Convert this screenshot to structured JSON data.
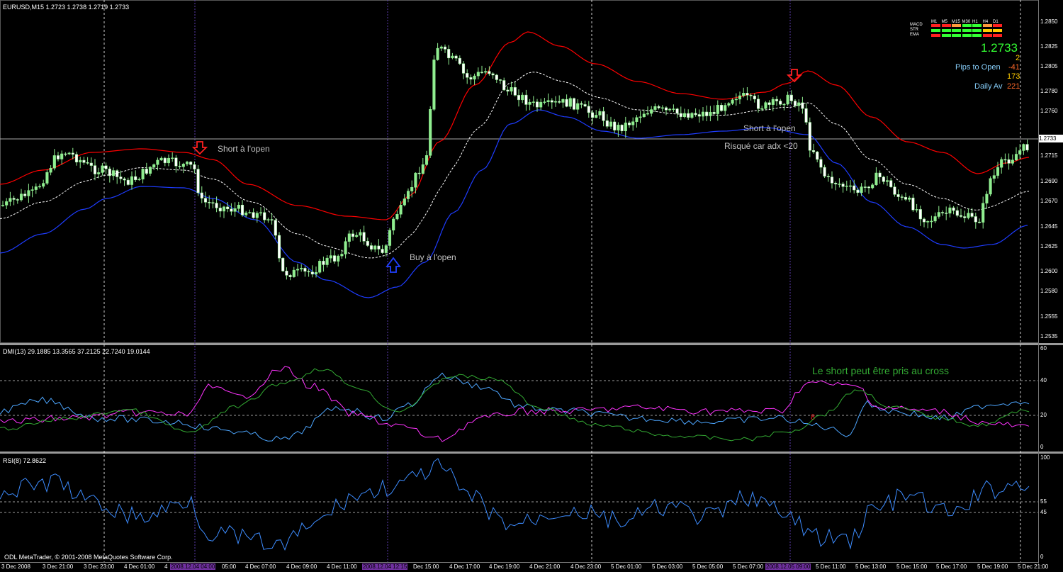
{
  "header": {
    "symbol": "EURUSD,M15  1.2723 1.2738 1.2719 1.2733",
    "dmi": "DMI(13) 29.1885 13.3565 37.2125 22.7240 19.0144",
    "rsi": "RSI(8) 72.8622"
  },
  "copyright": "ODL MetaTrader, © 2001-2008 MetaQuotes Software Corp.",
  "price_axis": [
    "1.2850",
    "1.2825",
    "1.2805",
    "1.2780",
    "1.2760",
    "1.2715",
    "1.2690",
    "1.2670",
    "1.2645",
    "1.2625",
    "1.2600",
    "1.2580",
    "1.2555",
    "1.2535"
  ],
  "current_price": "1.2733",
  "dmi_axis": [
    "60",
    "40",
    "20",
    "0"
  ],
  "rsi_axis": [
    "100",
    "55",
    "45",
    "0"
  ],
  "time_axis": [
    {
      "label": "3 Dec 2008",
      "hl": false
    },
    {
      "label": "3 Dec 21:00",
      "hl": false
    },
    {
      "label": "3 Dec 23:00",
      "hl": false
    },
    {
      "label": "4 Dec 01:00",
      "hl": false
    },
    {
      "label": "4",
      "hl": false
    },
    {
      "label": "2008.12.04 04:00",
      "hl": true
    },
    {
      "label": "05:00",
      "hl": false
    },
    {
      "label": "4 Dec 07:00",
      "hl": false
    },
    {
      "label": "4 Dec 09:00",
      "hl": false
    },
    {
      "label": "4 Dec 11:00",
      "hl": false
    },
    {
      "label": "2008.12.04 12:15",
      "hl": true
    },
    {
      "label": "Dec 15:00",
      "hl": false
    },
    {
      "label": "4 Dec 17:00",
      "hl": false
    },
    {
      "label": "4 Dec 19:00",
      "hl": false
    },
    {
      "label": "4 Dec 21:00",
      "hl": false
    },
    {
      "label": "4 Dec 23:00",
      "hl": false
    },
    {
      "label": "5 Dec 01:00",
      "hl": false
    },
    {
      "label": "5 Dec 03:00",
      "hl": false
    },
    {
      "label": "5 Dec 05:00",
      "hl": false
    },
    {
      "label": "5 Dec 07:00",
      "hl": false
    },
    {
      "label": "2008.12.05 09:00",
      "hl": true
    },
    {
      "label": "5 Dec 11:00",
      "hl": false
    },
    {
      "label": "5 Dec 13:00",
      "hl": false
    },
    {
      "label": "5 Dec 15:00",
      "hl": false
    },
    {
      "label": "5 Dec 17:00",
      "hl": false
    },
    {
      "label": "5 Dec 19:00",
      "hl": false
    },
    {
      "label": "5 Dec 21:00",
      "hl": false
    }
  ],
  "annotations": {
    "short1": "Short à l'open",
    "buy": "Buy à l'open",
    "short2": "Short à l'open",
    "risk": "Risqué car adx <20",
    "cross": "Le short peut être pris au cross"
  },
  "info_panel": {
    "tf_headers": [
      "M1",
      "M5",
      "M15",
      "M30",
      "H1",
      "H4",
      "D1"
    ],
    "rows": [
      "MACD",
      "STR",
      "EMA"
    ],
    "price": "1.2733",
    "spread": "2",
    "pips_label": "Pips to Open",
    "pips_value": "-41",
    "range_value": "173",
    "daily_label": "Daily Av",
    "daily_value": "221"
  },
  "colors": {
    "bull": "#90ee90",
    "bear": "#ffffff",
    "upper_band": "#ff0000",
    "lower_band": "#1e3cff",
    "mid_band": "#ffffff",
    "dmi_plus": "#4da6ff",
    "dmi_minus": "#ff33ff",
    "adx": "#33aa33",
    "rsi": "#3d8cff",
    "sell_arrow": "#ff2020",
    "buy_arrow": "#2040ff"
  }
}
